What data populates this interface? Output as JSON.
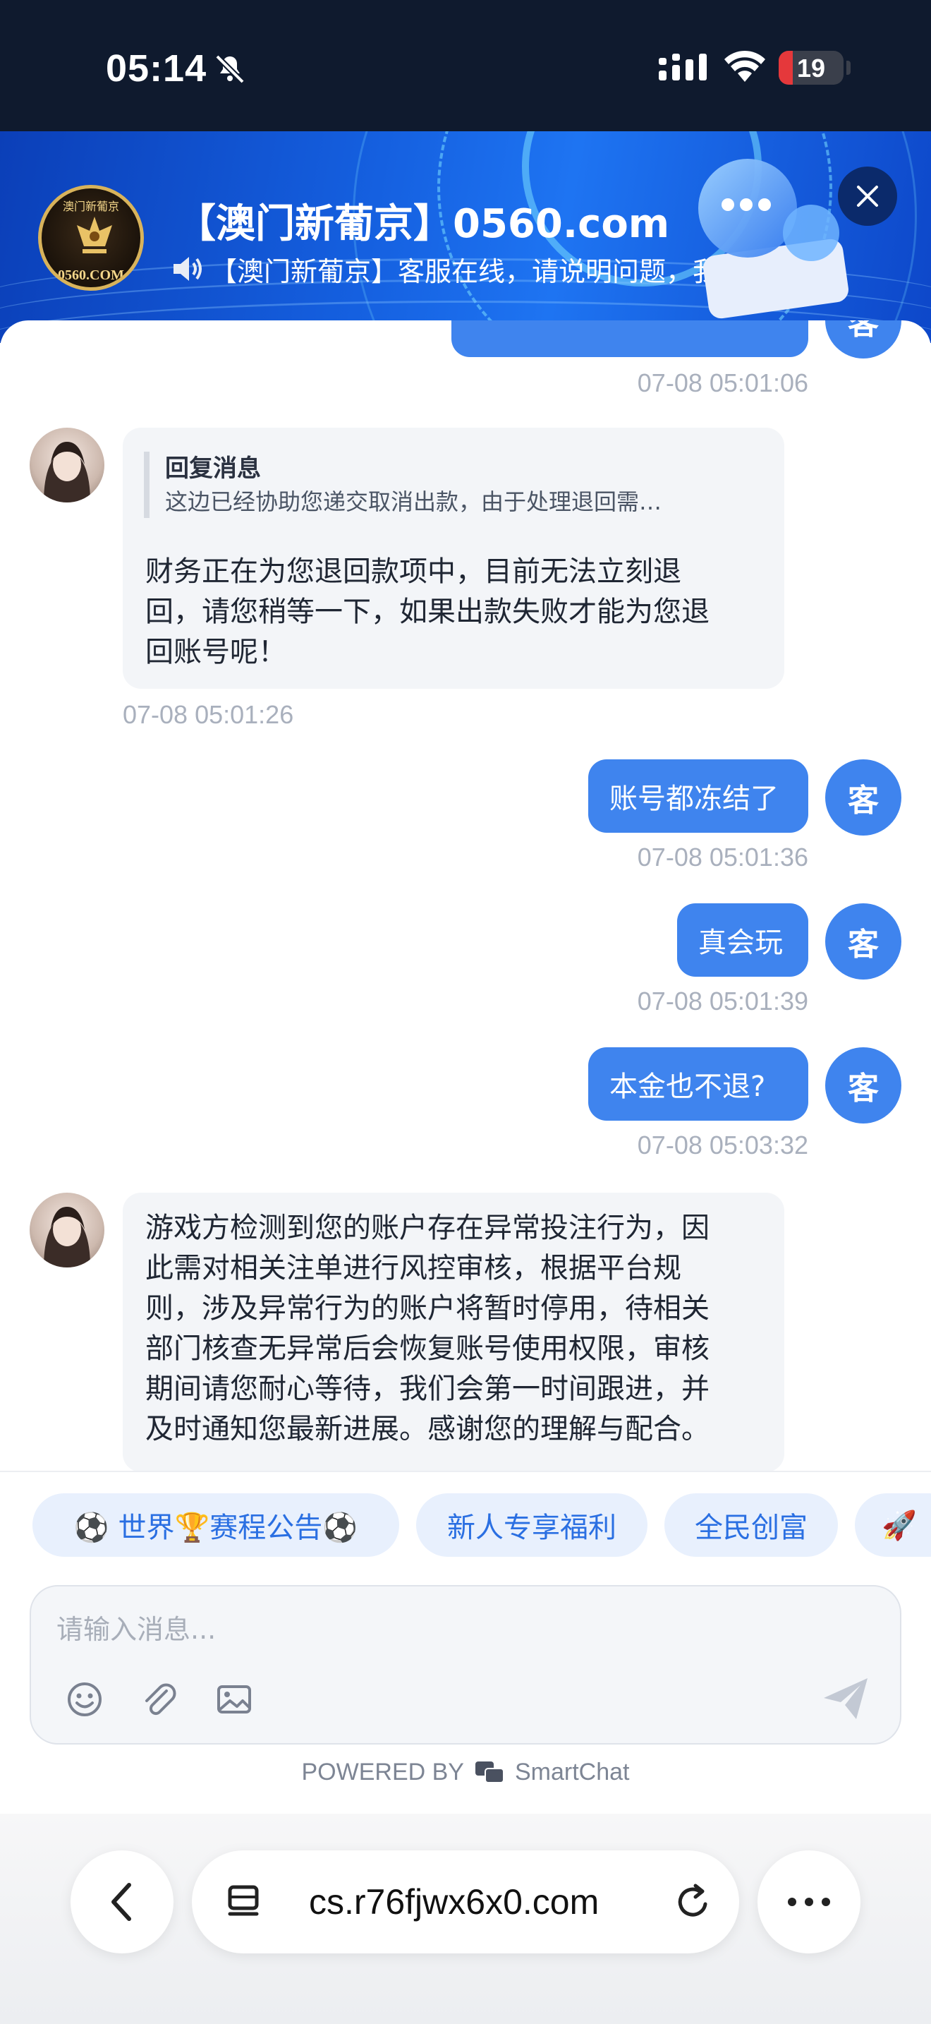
{
  "status_bar": {
    "time": "05:14",
    "battery": "19",
    "icons": [
      "bell-slash-icon",
      "signal-icon",
      "wifi-icon",
      "battery-icon"
    ]
  },
  "header": {
    "title": "【澳门新葡京】0560.com",
    "subtitle": "【澳门新葡京】客服在线，请说明问题，我们第…",
    "logo_text": "0560.COM",
    "logo_cn": "澳门新葡京",
    "accent": "#1560e0"
  },
  "chat": {
    "partial_message_ts": "07-08 05:01:06",
    "agent_reply": {
      "quote_title": "回复消息",
      "quote_body": "这边已经协助您递交取消出款，由于处理退回需…",
      "lines": [
        "财务正在为您退回款项中，目前无法立刻退",
        "回，请您稍等一下，如果出款失败才能为您退",
        "回账号呢！"
      ],
      "ts": "07-08 05:01:26"
    },
    "user_messages": [
      {
        "text": "账号都冻结了",
        "ts": "07-08 05:01:36",
        "avatar": "客"
      },
      {
        "text": "真会玩",
        "ts": "07-08 05:01:39",
        "avatar": "客"
      },
      {
        "text": "本金也不退?",
        "ts": "07-08 05:03:32",
        "avatar": "客"
      }
    ],
    "partial_user_avatar": "客",
    "agent_message_2": {
      "lines": [
        "游戏方检测到您的账户存在异常投注行为，因",
        "此需对相关注单进行风控审核，根据平台规",
        "则，涉及异常行为的账户将暂时停用，待相关",
        "部门核查无异常后会恢复账号使用权限，审核",
        "期间请您耐心等待，我们会第一时间跟进，并",
        "及时通知您最新进展。感谢您的理解与配合。"
      ]
    }
  },
  "quick_replies": [
    "⚽ 世界🏆赛程公告⚽",
    "新人专享福利",
    "全民创富",
    "🚀"
  ],
  "composer": {
    "placeholder": "请输入消息...",
    "tools": [
      "emoji-icon",
      "attachment-icon",
      "image-icon"
    ],
    "send_icon": "send-icon"
  },
  "powered_by": {
    "prefix": "POWERED BY",
    "brand": "SmartChat"
  },
  "browser": {
    "url": "cs.r76fjwx6x0.com"
  }
}
